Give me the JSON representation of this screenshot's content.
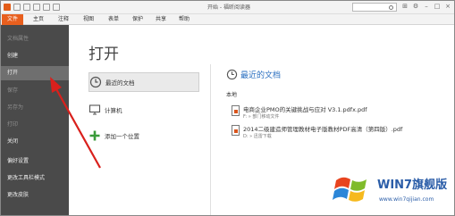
{
  "window": {
    "title": "开始 - 福昕阅读器"
  },
  "search": {
    "placeholder": "",
    "value": ""
  },
  "menu": {
    "tabs": [
      {
        "label": "文件"
      },
      {
        "label": "主页"
      },
      {
        "label": "注释"
      },
      {
        "label": "视图"
      },
      {
        "label": "表单"
      },
      {
        "label": "保护"
      },
      {
        "label": "共享"
      },
      {
        "label": "帮助"
      }
    ]
  },
  "sidebar": {
    "items": [
      {
        "label": "文档属性"
      },
      {
        "label": "创建"
      },
      {
        "label": "打开"
      },
      {
        "label": "保存"
      },
      {
        "label": "另存为"
      },
      {
        "label": "打印"
      },
      {
        "label": "关闭"
      },
      {
        "label": "偏好设置"
      },
      {
        "label": "更改工具栏模式"
      },
      {
        "label": "更改皮肤"
      }
    ]
  },
  "main": {
    "title": "打开",
    "sources": [
      {
        "label": "最近的文档",
        "icon": "clock-icon"
      },
      {
        "label": "计算机",
        "icon": "computer-icon"
      },
      {
        "label": "添加一个位置",
        "icon": "plus-icon"
      }
    ],
    "recent": {
      "title": "最近的文档",
      "section": "本地",
      "files": [
        {
          "name": "电商企业PMO的关键挑战与应对 V3.1.pdfx.pdf",
          "path": "F: » 部门移动文件"
        },
        {
          "name": "2014二级建造师管理教材电子版教材PDF高清（第四版）.pdf",
          "path": "D: » 迅雷下载"
        }
      ]
    }
  },
  "watermark": {
    "text": "WIN7旗舰版",
    "url": "www.win7qijian.com"
  },
  "colors": {
    "accent": "#e85f1e",
    "sidebar": "#4a4a4a",
    "link_blue": "#2a6fc0",
    "arrow": "#d9201c"
  }
}
